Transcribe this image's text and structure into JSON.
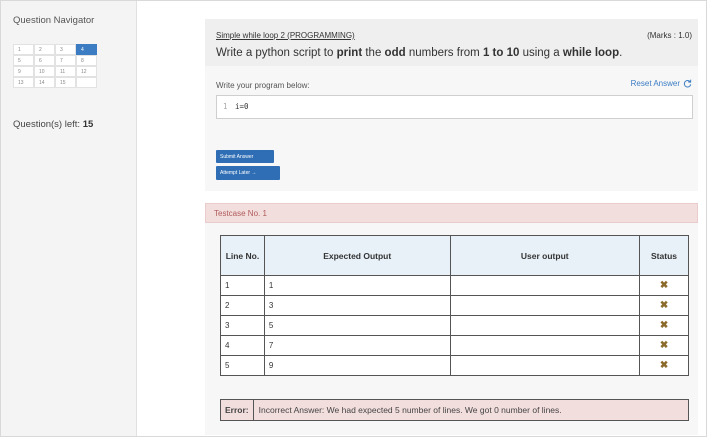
{
  "sidebar": {
    "title": "Question Navigator",
    "questions": [
      {
        "label": "1",
        "state": "normal"
      },
      {
        "label": "2",
        "state": "normal"
      },
      {
        "label": "3",
        "state": "normal"
      },
      {
        "label": "4",
        "state": "active"
      },
      {
        "label": "5",
        "state": "normal"
      },
      {
        "label": "6",
        "state": "normal"
      },
      {
        "label": "7",
        "state": "normal"
      },
      {
        "label": "8",
        "state": "normal"
      },
      {
        "label": "9",
        "state": "normal"
      },
      {
        "label": "10",
        "state": "normal"
      },
      {
        "label": "11",
        "state": "normal"
      },
      {
        "label": "12",
        "state": "normal"
      },
      {
        "label": "13",
        "state": "normal"
      },
      {
        "label": "14",
        "state": "normal"
      },
      {
        "label": "15",
        "state": "normal"
      }
    ],
    "questions_left_label": "Question(s) left:",
    "questions_left_count": "15"
  },
  "question": {
    "title": "Simple while loop 2 (PROGRAMMING)",
    "marks": "(Marks : 1.0)",
    "text_parts": [
      {
        "t": "Write a python script to ",
        "b": false
      },
      {
        "t": "print",
        "b": true
      },
      {
        "t": " the ",
        "b": false
      },
      {
        "t": "odd",
        "b": true
      },
      {
        "t": " numbers from ",
        "b": false
      },
      {
        "t": "1 to 10",
        "b": true
      },
      {
        "t": " using a ",
        "b": false
      },
      {
        "t": "while loop",
        "b": true
      },
      {
        "t": ".",
        "b": false
      }
    ]
  },
  "editor": {
    "label": "Write your program below:",
    "reset_label": "Reset Answer",
    "line_number": "1",
    "code": "i=0"
  },
  "buttons": {
    "submit": "Submit Answer",
    "later": "Attempt Later →"
  },
  "testcase": {
    "label": "Testcase No. 1",
    "headers": [
      "Line No.",
      "Expected Output",
      "User output",
      "Status"
    ],
    "rows": [
      {
        "line": "1",
        "expected": "1",
        "user": "",
        "status": "✖"
      },
      {
        "line": "2",
        "expected": "3",
        "user": "",
        "status": "✖"
      },
      {
        "line": "3",
        "expected": "5",
        "user": "",
        "status": "✖"
      },
      {
        "line": "4",
        "expected": "7",
        "user": "",
        "status": "✖"
      },
      {
        "line": "5",
        "expected": "9",
        "user": "",
        "status": "✖"
      }
    ],
    "error_label": "Error:",
    "error_message": "Incorrect Answer: We had expected 5 number of lines. We got 0 number of lines."
  },
  "colors": {
    "accent": "#3b7cc3",
    "button": "#2f6eb5",
    "error_bg": "#f3dede",
    "header_bg": "#e8f1f8",
    "status_x": "#8b6a2a"
  },
  "icons": {
    "reset": "refresh-icon",
    "status_fail": "cross-icon"
  }
}
